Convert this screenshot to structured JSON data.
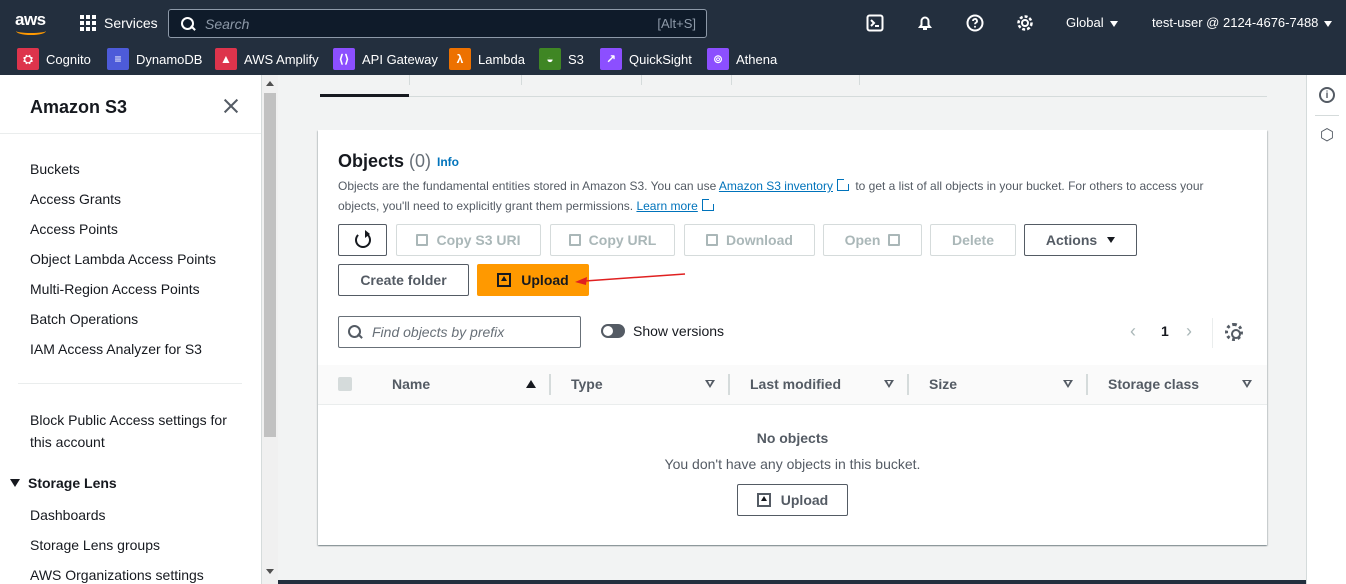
{
  "nav": {
    "logo": "aws",
    "services": "Services",
    "search_placeholder": "Search",
    "search_shortcut": "[Alt+S]",
    "region": "Global",
    "user": "test-user @ 2124-4676-7488"
  },
  "favorites": [
    {
      "label": "Cognito",
      "color": "#dd344c"
    },
    {
      "label": "DynamoDB",
      "color": "#4d5bd9"
    },
    {
      "label": "AWS Amplify",
      "color": "#dd344c"
    },
    {
      "label": "API Gateway",
      "color": "#8c4fff"
    },
    {
      "label": "Lambda",
      "color": "#ed7100"
    },
    {
      "label": "S3",
      "color": "#3f8624"
    },
    {
      "label": "QuickSight",
      "color": "#8c4fff"
    },
    {
      "label": "Athena",
      "color": "#8c4fff"
    }
  ],
  "sidebar": {
    "title": "Amazon S3",
    "items": [
      "Buckets",
      "Access Grants",
      "Access Points",
      "Object Lambda Access Points",
      "Multi-Region Access Points",
      "Batch Operations",
      "IAM Access Analyzer for S3"
    ],
    "block_public_1": "Block Public Access settings for",
    "block_public_2": "this account",
    "storage_lens": "Storage Lens",
    "lens_items": [
      "Dashboards",
      "Storage Lens groups",
      "AWS Organizations settings"
    ]
  },
  "objects": {
    "title": "Objects",
    "count": "(0)",
    "info": "Info",
    "desc_1": "Objects are the fundamental entities stored in Amazon S3. You can use ",
    "desc_link1": "Amazon S3 inventory",
    "desc_2": " to get a list of all objects in your bucket. For others to access your objects, you'll need to explicitly grant them permissions. ",
    "desc_link2": "Learn more",
    "buttons": {
      "copy_uri": "Copy S3 URI",
      "copy_url": "Copy URL",
      "download": "Download",
      "open": "Open",
      "delete": "Delete",
      "actions": "Actions",
      "create_folder": "Create folder",
      "upload": "Upload"
    },
    "find_placeholder": "Find objects by prefix",
    "show_versions": "Show versions",
    "page": "1",
    "columns": [
      "Name",
      "Type",
      "Last modified",
      "Size",
      "Storage class"
    ],
    "empty_title": "No objects",
    "empty_desc": "You don't have any objects in this bucket.",
    "empty_upload": "Upload"
  },
  "colors": {
    "primary": "#ff9900",
    "link": "#0073bb",
    "nav": "#232f3e",
    "annotation": "#e02020"
  }
}
